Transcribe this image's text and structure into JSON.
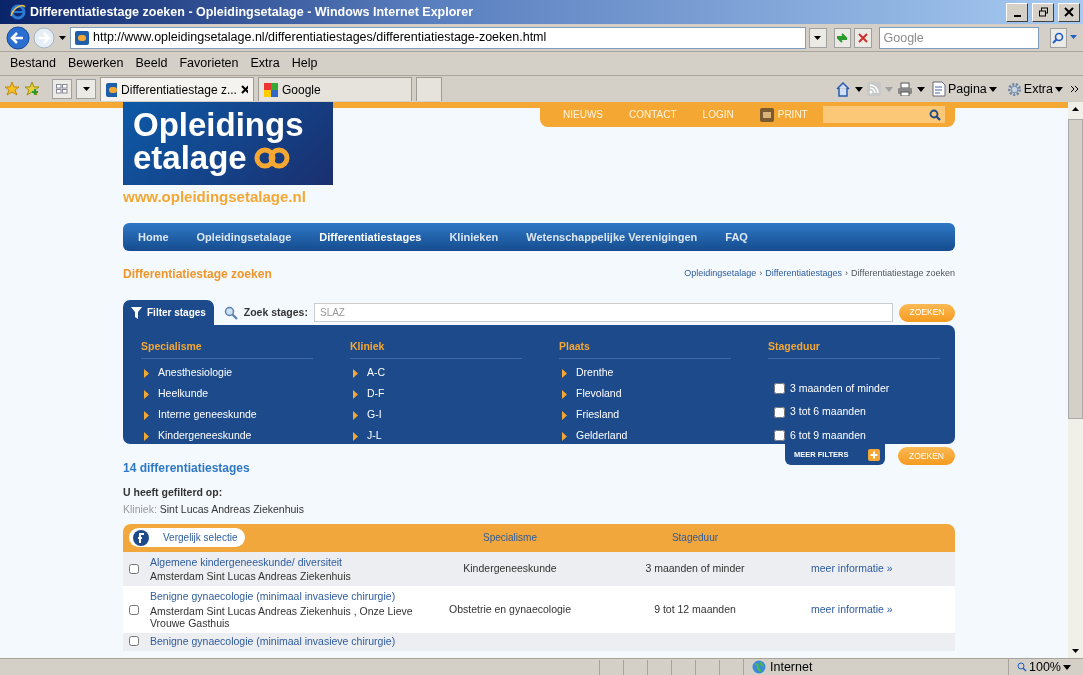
{
  "window": {
    "title": "Differentiatiestage zoeken - Opleidingsetalage - Windows Internet Explorer"
  },
  "address_bar": {
    "url": "http://www.opleidingsetalage.nl/differentiatiestages/differentiatiestage-zoeken.html"
  },
  "search_box": {
    "placeholder": "Google"
  },
  "menu": [
    "Bestand",
    "Bewerken",
    "Beeld",
    "Favorieten",
    "Extra",
    "Help"
  ],
  "browser_tabs": [
    {
      "label": "Differentiatiestage z...",
      "selected": true
    },
    {
      "label": "Google",
      "selected": false
    }
  ],
  "command_bar": [
    "Pagina",
    "Extra"
  ],
  "site": {
    "logo": {
      "line1": "Opleidings",
      "line2": "etalage"
    },
    "url": "www.opleidingsetalage.nl",
    "top_links": [
      "NIEUWS",
      "CONTACT",
      "LOGIN"
    ],
    "print": "PRINT",
    "nav": [
      {
        "label": "Home",
        "selected": false
      },
      {
        "label": "Opleidingsetalage",
        "selected": false
      },
      {
        "label": "Differentiatiestages",
        "selected": true
      },
      {
        "label": "Klinieken",
        "selected": false
      },
      {
        "label": "Wetenschappelijke Verenigingen",
        "selected": false
      },
      {
        "label": "FAQ",
        "selected": false
      }
    ],
    "page_title": "Differentiatiestage zoeken",
    "breadcrumb": {
      "items": [
        "Opleidingsetalage",
        "Differentiatiestages",
        "Differentiatiestage zoeken"
      ],
      "separator": "›"
    },
    "filter": {
      "tab": "Filter stages",
      "search_label": "Zoek stages:",
      "search_placeholder": "SLAZ",
      "button": "ZOEKEN",
      "columns": [
        {
          "kind": "links",
          "heading": "Specialisme",
          "items": [
            "Anesthesiologie",
            "Heelkunde",
            "Interne geneeskunde",
            "Kindergeneeskunde"
          ]
        },
        {
          "kind": "links",
          "heading": "Kliniek",
          "items": [
            "A-C",
            "D-F",
            "G-I",
            "J-L"
          ]
        },
        {
          "kind": "links",
          "heading": "Plaats",
          "items": [
            "Drenthe",
            "Flevoland",
            "Friesland",
            "Gelderland"
          ]
        },
        {
          "kind": "checks",
          "heading": "Stageduur",
          "items": [
            {
              "label": "3 maanden of minder",
              "checked": false
            },
            {
              "label": "3 tot 6 maanden",
              "checked": false
            },
            {
              "label": "6 tot 9 maanden",
              "checked": false
            }
          ]
        }
      ],
      "more_filters": "MEER FILTERS",
      "second_button": "ZOEKEN"
    },
    "result_count": "14 differentiatiestages",
    "filtered_heading": "U heeft gefilterd op:",
    "active_filter": {
      "label": "Kliniek:",
      "value": "Sint Lucas Andreas Ziekenhuis"
    },
    "table": {
      "compare": "Vergelijk selectie",
      "columns": [
        "Specialisme",
        "Stageduur"
      ],
      "rows": [
        {
          "checked": false,
          "title": "Algemene kindergeneeskunde/ diversiteit",
          "location": "Amsterdam Sint Lucas Andreas Ziekenhuis",
          "specialisme": "Kindergeneeskunde",
          "duur": "3 maanden of minder",
          "link": "meer informatie »"
        },
        {
          "checked": false,
          "title": "Benigne gynaecologie (minimaal invasieve chirurgie)",
          "location": "Amsterdam Sint Lucas Andreas Ziekenhuis , Onze Lieve Vrouwe Gasthuis",
          "specialisme": "Obstetrie en gynaecologie",
          "duur": "9 tot 12 maanden",
          "link": "meer informatie »"
        },
        {
          "checked": false,
          "title": "Benigne gynaecologie (minimaal invasieve chirurgie)"
        }
      ]
    }
  },
  "status_bar": {
    "zone": "Internet",
    "zoom": "100%"
  }
}
